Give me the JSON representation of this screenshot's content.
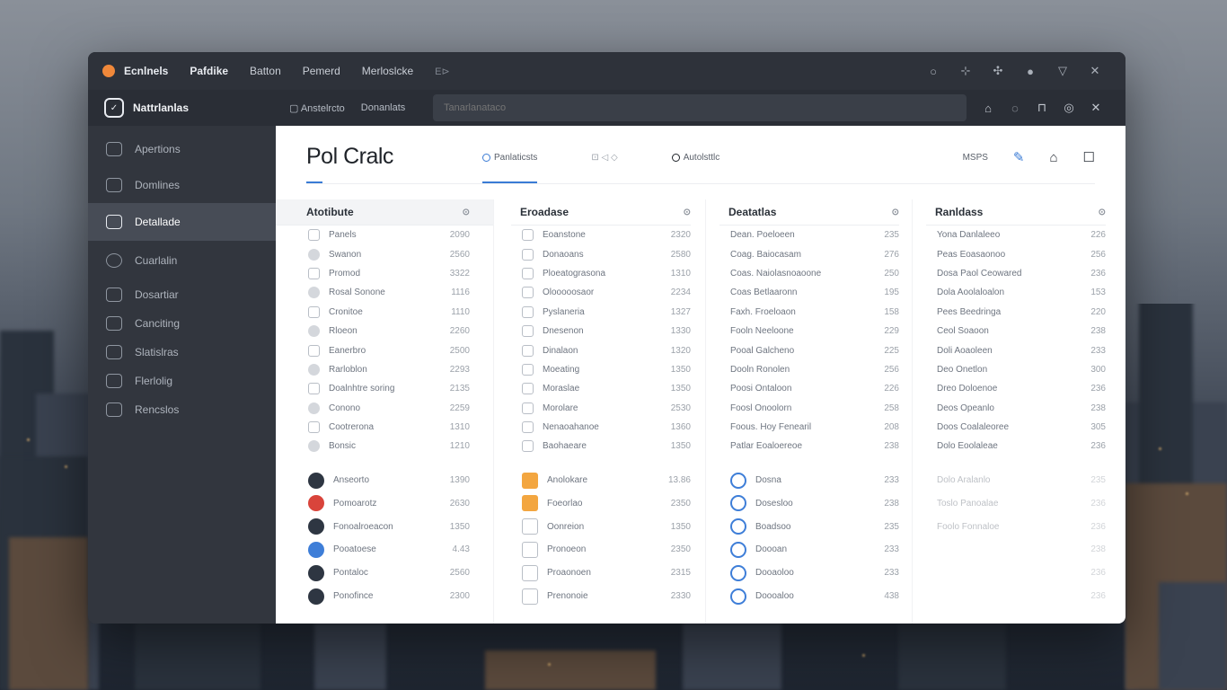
{
  "window": {
    "menu": [
      "Ecnlnels",
      "Pafdike",
      "Batton",
      "Pemerd",
      "Merloslcke"
    ],
    "menu_extra": "E⊳",
    "controls": [
      "○",
      "⊹",
      "✣",
      "●",
      "▽",
      "✕"
    ]
  },
  "toolbar": {
    "brand": "Nattrlanlas",
    "links": [
      "Anstelrcto",
      "Donanlats"
    ],
    "search_placeholder": "Tanarlanataco",
    "icons": [
      "⌂",
      "◌",
      "⊓",
      "◎",
      "✕"
    ]
  },
  "sidebar": {
    "items": [
      {
        "label": "Apertions",
        "active": false
      },
      {
        "label": "Domlines",
        "active": false
      },
      {
        "label": "Detallade",
        "active": true
      },
      {
        "label": "Cuarlalin",
        "active": false
      },
      {
        "label": "Dosartiar",
        "active": false
      },
      {
        "label": "Canciting",
        "active": false
      },
      {
        "label": "Slatislras",
        "active": false
      },
      {
        "label": "Flerlolig",
        "active": false
      },
      {
        "label": "Rencslos",
        "active": false
      }
    ]
  },
  "main": {
    "title": "Pol Cralc",
    "tabs": [
      "Panlaticsts",
      "Autolsttlc"
    ],
    "tab_mini": "⊡ ◁ ◇",
    "header_code": "MSPS"
  },
  "columns": [
    {
      "title": "Atotibute",
      "rows": [
        [
          "Panels",
          "2090"
        ],
        [
          "Swanon",
          "2560"
        ],
        [
          "Promod",
          "3322"
        ],
        [
          "Rosal Sonone",
          "1116"
        ],
        [
          "Cronitoe",
          "1110"
        ],
        [
          "Rloeon",
          "2260"
        ],
        [
          "Eanerbro",
          "2500"
        ],
        [
          "Rarloblon",
          "2293"
        ],
        [
          "Doalnhtre soring",
          "2135"
        ],
        [
          "Conono",
          "2259"
        ],
        [
          "Cootrerona",
          "1310"
        ],
        [
          "Bonsic",
          "1210"
        ]
      ],
      "sub": [
        [
          "Anseorto",
          "1390"
        ],
        [
          "Pomoarotz",
          "2630"
        ],
        [
          "Fonoalroeacon",
          "1350"
        ],
        [
          "Pooatoese",
          "4.43"
        ],
        [
          "Pontaloc",
          "2560"
        ],
        [
          "Ponofince",
          "2300"
        ]
      ]
    },
    {
      "title": "Eroadase",
      "rows": [
        [
          "Eoanstone",
          "2320"
        ],
        [
          "Donaoans",
          "2580"
        ],
        [
          "Ploeatograsona",
          "1310"
        ],
        [
          "Olooooosaor",
          "2234"
        ],
        [
          "Pyslaneria",
          "1327"
        ],
        [
          "Dnesenon",
          "1330"
        ],
        [
          "Dinalaon",
          "1320"
        ],
        [
          "Moeating",
          "1350"
        ],
        [
          "Moraslae",
          "1350"
        ],
        [
          "Morolare",
          "2530"
        ],
        [
          "Nenaoahanoe",
          "1360"
        ],
        [
          "Baohaeare",
          "1350"
        ]
      ],
      "sub": [
        [
          "Anolokare",
          "13.86"
        ],
        [
          "Foeorlao",
          "2350"
        ],
        [
          "Oonreion",
          "1350"
        ],
        [
          "Pronoeon",
          "2350"
        ],
        [
          "Proaonoen",
          "2315"
        ],
        [
          "Prenonoie",
          "2330"
        ]
      ]
    },
    {
      "title": "Deatatlas",
      "rows": [
        [
          "Dean. Poeloeen",
          "235"
        ],
        [
          "Coag. Baiocasam",
          "276"
        ],
        [
          "Coas. Naiolasnoaoone",
          "250"
        ],
        [
          "Coas Betlaaronn",
          "195"
        ],
        [
          "Faxh. Froeloaon",
          "158"
        ],
        [
          "Fooln Neeloone",
          "229"
        ],
        [
          "Pooal Galcheno",
          "225"
        ],
        [
          "Dooln Ronolen",
          "256"
        ],
        [
          "Poosi Ontaloon",
          "226"
        ],
        [
          "Foosl Onoolorn",
          "258"
        ],
        [
          "Foous. Hoy Fenearil",
          "208"
        ],
        [
          "Patlar Eoaloereoe",
          "238"
        ]
      ],
      "sub": [
        [
          "Dosna",
          "233"
        ],
        [
          "Dosesloo",
          "238"
        ],
        [
          "Boadsoo",
          "235"
        ],
        [
          "Doooan",
          "233"
        ],
        [
          "Dooaoloo",
          "233"
        ],
        [
          "Doooaloo",
          "438"
        ]
      ]
    },
    {
      "title": "Ranldass",
      "rows": [
        [
          "Yona Danlaleeo",
          "226"
        ],
        [
          "Peas Eoasaonoo",
          "256"
        ],
        [
          "Dosa Paol Ceowared",
          "236"
        ],
        [
          "Dola Aoolaloalon",
          "153"
        ],
        [
          "Pees Beedringa",
          "220"
        ],
        [
          "Ceol Soaoon",
          "238"
        ],
        [
          "Doli Aoaoleen",
          "233"
        ],
        [
          "Deo Onetlon",
          "300"
        ],
        [
          "Dreo Doloenoe",
          "236"
        ],
        [
          "Deos Opeanlo",
          "238"
        ],
        [
          "Doos Coalaleoree",
          "305"
        ],
        [
          "Dolo Eoolaleae",
          "236"
        ]
      ],
      "sub": [
        [
          "Dolo Aralanlo",
          "235"
        ],
        [
          "Toslo Panoalae",
          "236"
        ],
        [
          "Foolo Fonnaloe",
          "236"
        ],
        [
          "",
          "238"
        ],
        [
          "",
          "236"
        ],
        [
          "",
          "236"
        ]
      ]
    }
  ],
  "colors": {
    "accent": "#3a7bd5",
    "orange": "#f0883a",
    "red": "#d9443b"
  }
}
